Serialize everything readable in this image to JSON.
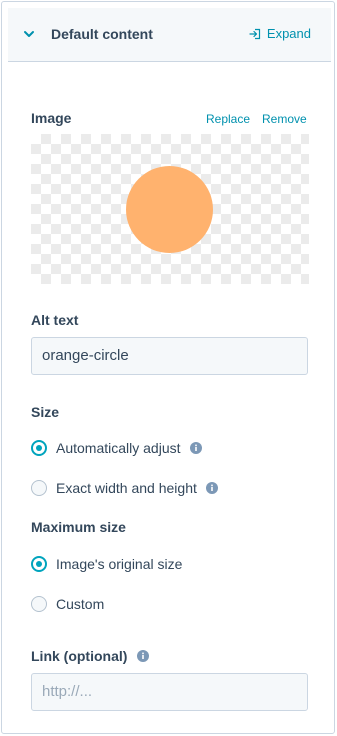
{
  "header": {
    "title": "Default content",
    "expand_label": "Expand"
  },
  "image": {
    "label": "Image",
    "replace_label": "Replace",
    "remove_label": "Remove",
    "circle_color": "#ffb26e"
  },
  "alt_text": {
    "label": "Alt text",
    "value": "orange-circle"
  },
  "size": {
    "label": "Size",
    "options": [
      {
        "label": "Automatically adjust",
        "selected": true
      },
      {
        "label": "Exact width and height",
        "selected": false
      }
    ]
  },
  "max_size": {
    "label": "Maximum size",
    "options": [
      {
        "label": "Image's original size",
        "selected": true
      },
      {
        "label": "Custom",
        "selected": false
      }
    ]
  },
  "link": {
    "label": "Link (optional)",
    "placeholder": "http://..."
  },
  "colors": {
    "accent": "#0091ae",
    "radio_selected": "#00a4bd",
    "text": "#33475b"
  }
}
